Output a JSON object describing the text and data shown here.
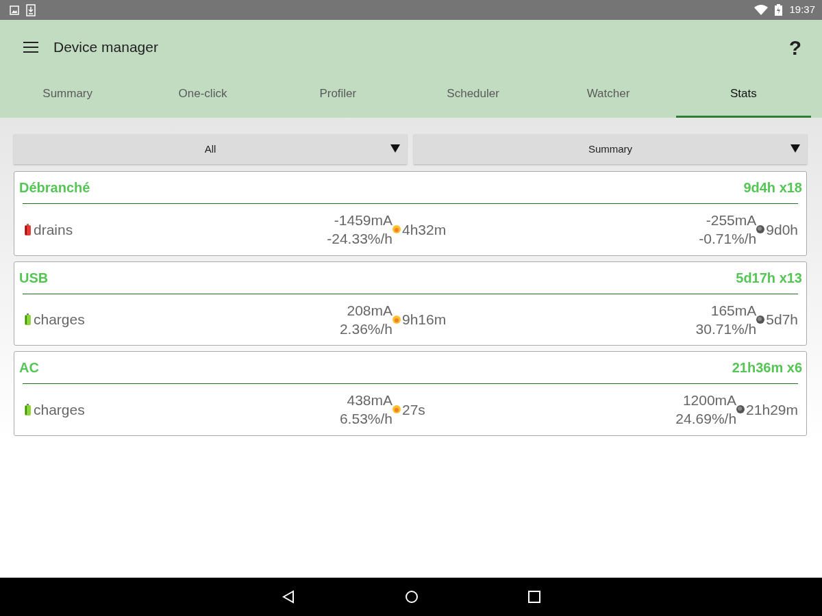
{
  "status_bar": {
    "time": "19:37"
  },
  "app_bar": {
    "title": "Device manager",
    "help": "?"
  },
  "tabs": [
    {
      "label": "Summary",
      "selected": false
    },
    {
      "label": "One-click",
      "selected": false
    },
    {
      "label": "Profiler",
      "selected": false
    },
    {
      "label": "Scheduler",
      "selected": false
    },
    {
      "label": "Watcher",
      "selected": false
    },
    {
      "label": "Stats",
      "selected": true
    }
  ],
  "filters": [
    {
      "value": "All"
    },
    {
      "value": "Summary"
    }
  ],
  "cards": [
    {
      "title": "Débranché",
      "total": "9d4h x18",
      "kind": "drains",
      "label": "drains",
      "screen_on": {
        "current": "-1459mA",
        "rate": "-24.33%/h",
        "duration": "4h32m"
      },
      "screen_off": {
        "current": "-255mA",
        "rate": "-0.71%/h",
        "duration": "9d0h"
      }
    },
    {
      "title": "USB",
      "total": "5d17h x13",
      "kind": "charges",
      "label": "charges",
      "screen_on": {
        "current": "208mA",
        "rate": "2.36%/h",
        "duration": "9h16m"
      },
      "screen_off": {
        "current": "165mA",
        "rate": "30.71%/h",
        "duration": "5d7h"
      }
    },
    {
      "title": "AC",
      "total": "21h36m x6",
      "kind": "charges",
      "label": "charges",
      "screen_on": {
        "current": "438mA",
        "rate": "6.53%/h",
        "duration": "27s"
      },
      "screen_off": {
        "current": "1200mA",
        "rate": "24.69%/h",
        "duration": "21h29m"
      }
    }
  ]
}
